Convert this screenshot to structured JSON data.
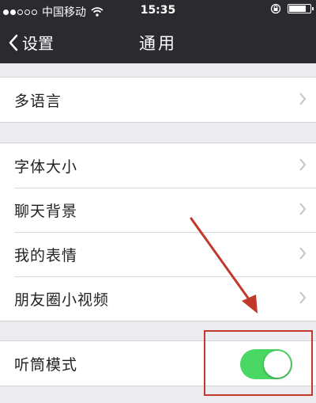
{
  "status_bar": {
    "signal_dots_filled": 2,
    "signal_dots_total": 5,
    "carrier": "中国移动",
    "time": "15:35",
    "icons": [
      "wifi-icon",
      "rotation-lock-icon",
      "battery-icon"
    ],
    "battery_level": 0.85
  },
  "nav": {
    "back_label": "设置",
    "title": "通用"
  },
  "groups": [
    {
      "items": [
        {
          "label": "多语言",
          "type": "disclosure"
        }
      ]
    },
    {
      "items": [
        {
          "label": "字体大小",
          "type": "disclosure"
        },
        {
          "label": "聊天背景",
          "type": "disclosure"
        },
        {
          "label": "我的表情",
          "type": "disclosure"
        },
        {
          "label": "朋友圈小视频",
          "type": "disclosure"
        }
      ]
    },
    {
      "items": [
        {
          "label": "听筒模式",
          "type": "toggle",
          "value": true
        }
      ]
    }
  ],
  "colors": {
    "bar_background": "#2b2b2f",
    "page_background": "#ebebf0",
    "toggle_on": "#4bd763",
    "annotation": "#c0392b"
  },
  "annotation": {
    "shapes": [
      "red-arrow",
      "red-highlight-box"
    ],
    "target": "听筒模式 toggle"
  }
}
